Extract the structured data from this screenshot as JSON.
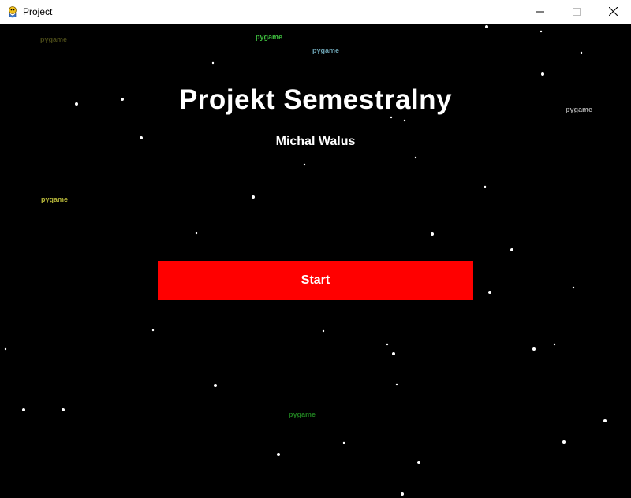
{
  "window": {
    "title": "Project",
    "icon": "pygame-snake-icon",
    "controls": [
      "minimize-icon",
      "maximize-icon",
      "close-icon"
    ]
  },
  "game": {
    "title": "Projekt Semestralny",
    "author": "Michal Walus",
    "start_label": "Start",
    "background_color": "#000000",
    "button_color": "#ff0000",
    "text_color": "#ffffff",
    "floating_labels": [
      "pygame",
      "pygame",
      "pygame",
      "pygame",
      "pygame",
      "pygame"
    ]
  }
}
